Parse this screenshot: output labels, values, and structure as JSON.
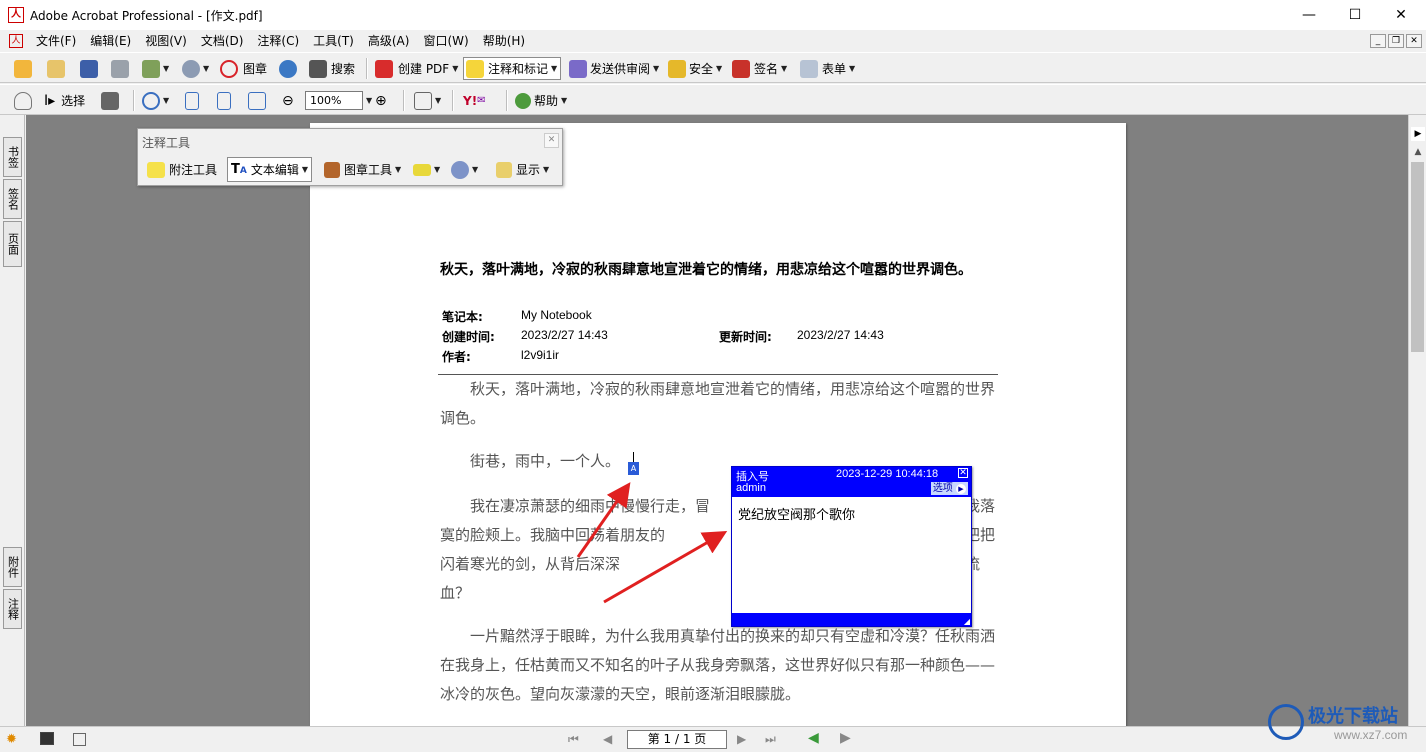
{
  "window": {
    "title": "Adobe Acrobat Professional - [作文.pdf]",
    "controls": {
      "minimize": "—",
      "maximize": "☐",
      "close": "✕"
    }
  },
  "menu": [
    "文件(F)",
    "编辑(E)",
    "视图(V)",
    "文档(D)",
    "注释(C)",
    "工具(T)",
    "高级(A)",
    "窗口(W)",
    "帮助(H)"
  ],
  "toolbar1": {
    "stamp": "图章",
    "search": "搜索",
    "create_pdf": "创建 PDF",
    "comment_markup": "注释和标记",
    "send_review": "发送供审阅",
    "security": "安全",
    "sign": "签名",
    "forms": "表单"
  },
  "toolbar2": {
    "select": "选择",
    "zoom": "100%",
    "yahoo": "Y!",
    "help": "帮助"
  },
  "left_tabs": {
    "bookmarks": "书签",
    "signatures": "签名",
    "pages": "页面",
    "attachments": "附件",
    "comments": "注释"
  },
  "comment_toolbar": {
    "title": "注释工具",
    "note_tool": "附注工具",
    "text_edit": "文本编辑",
    "stamp_tool": "图章工具",
    "show": "显示"
  },
  "document": {
    "title": "秋天，落叶满地，冷寂的秋雨肆意地宣泄着它的情绪，用悲凉给这个喧嚣的世界调色。",
    "meta": {
      "notebook_label": "笔记本:",
      "notebook": "My Notebook",
      "created_label": "创建时间:",
      "created": "2023/2/27 14:43",
      "updated_label": "更新时间:",
      "updated": "2023/2/27 14:43",
      "author_label": "作者:",
      "author": "l2v9i1ir"
    },
    "paragraphs": [
      "　　秋天，落叶满地，冷寂的秋雨肆意地宣泄着它的情绪，用悲凉给这个喧嚣的世界调色。",
      "　　街巷，雨中，一个人。",
      "　　我在凄凉萧瑟的细雨中慢慢行走，冒　　　　　　　　　　　　　　　印在我落寞的脸颊上。我脑中回荡着朋友的　　　　　　　　　　　　　　它们就像是一把把闪着寒光的剑，从背后深深　　　　　　　　　　　　　　雨在倾诉，还是心在流血？",
      "　　一片黯然浮于眼眸，为什么我用真挚付出的换来的却只有空虚和冷漠？任秋雨洒在我身上，任枯黄而又不知名的叶子从我身旁飘落，这世界好似只有那一种颜色——冰冷的灰色。望向灰濛濛的天空，眼前逐渐泪眼朦胧。"
    ]
  },
  "note": {
    "title": "插入号",
    "timestamp": "2023-12-29 10:44:18",
    "author": "admin",
    "options": "选项",
    "text": "党纪放空阀那个歌你",
    "marker": "A"
  },
  "statusbar": {
    "page_indicator": "第 1 / 1 页"
  },
  "watermark": {
    "name": "极光下载站",
    "url": "www.xz7.com"
  },
  "colors": {
    "note_blue": "#0000ff",
    "arrow_red": "#e02020",
    "doc_bg": "#808080"
  }
}
